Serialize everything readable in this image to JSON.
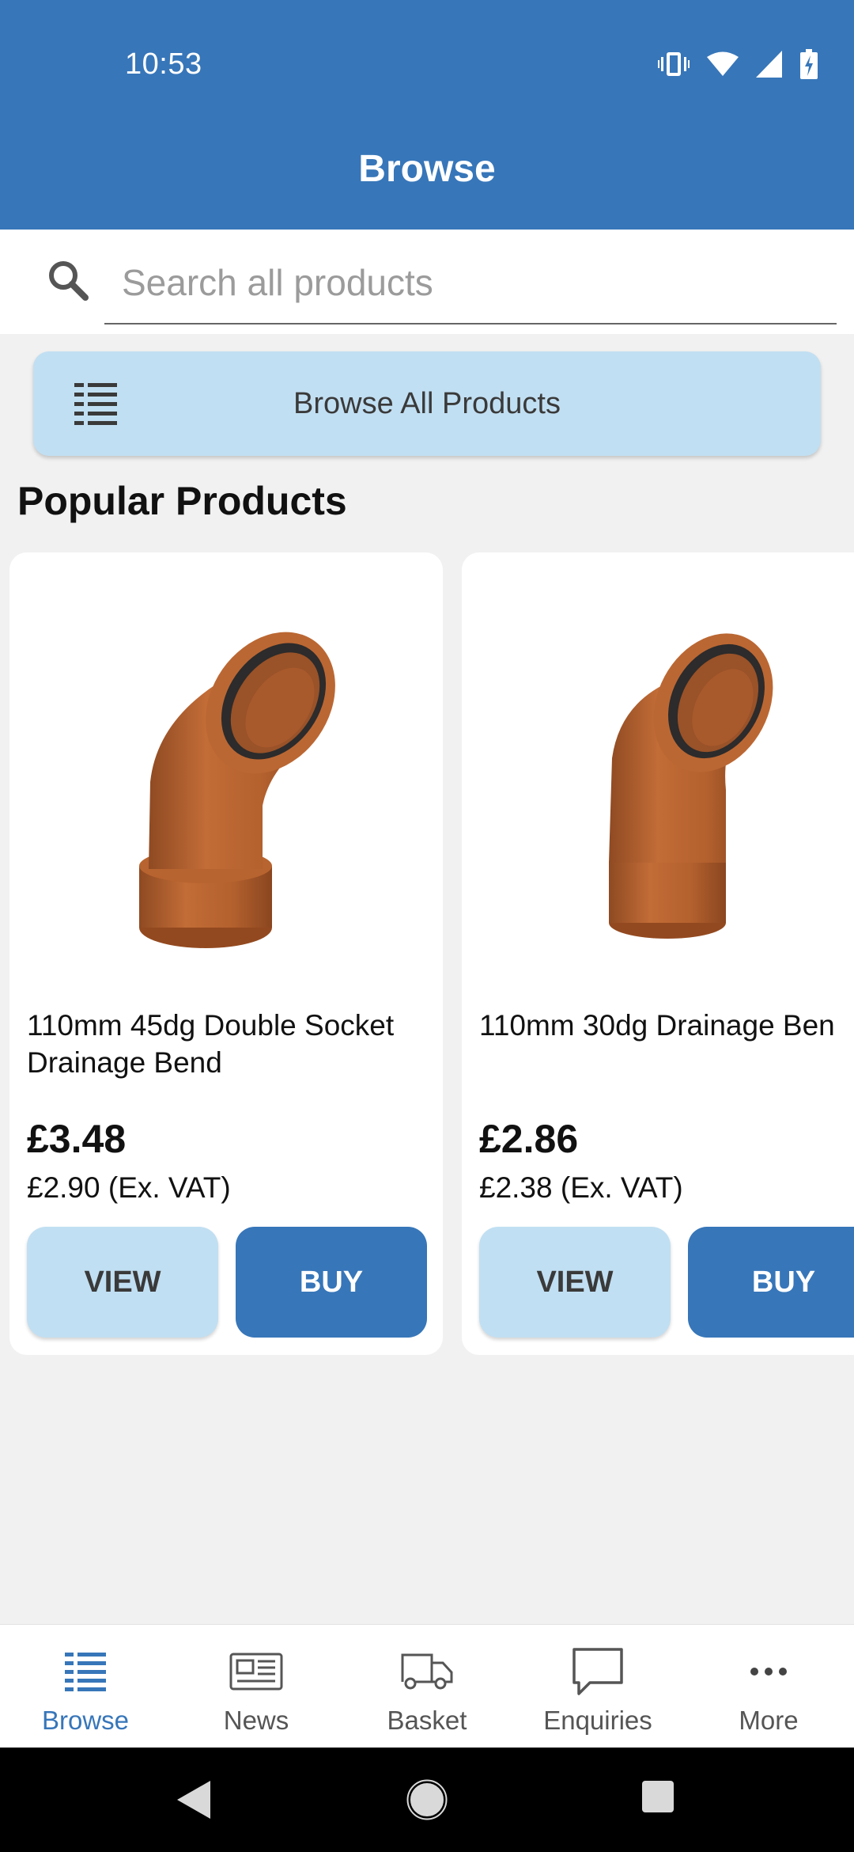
{
  "status_bar": {
    "time": "10:53",
    "icons": [
      "vibrate-icon",
      "wifi-icon",
      "signal-icon",
      "battery-charging-icon"
    ]
  },
  "header": {
    "title": "Browse"
  },
  "search": {
    "placeholder": "Search all products",
    "icon": "search-icon"
  },
  "browse_all": {
    "label": "Browse All Products",
    "icon": "list-icon"
  },
  "popular": {
    "title": "Popular Products",
    "products": [
      {
        "name": "110mm 45dg Double Socket Drainage Bend",
        "price": "£3.48",
        "price_ex_vat": "£2.90 (Ex. VAT)",
        "view_label": "VIEW",
        "buy_label": "BUY"
      },
      {
        "name": "110mm 30dg Drainage Ben",
        "price": "£2.86",
        "price_ex_vat": "£2.38 (Ex. VAT)",
        "view_label": "VIEW",
        "buy_label": "BUY"
      }
    ]
  },
  "bottom_nav": {
    "items": [
      {
        "label": "Browse",
        "icon": "list-icon",
        "active": true
      },
      {
        "label": "News",
        "icon": "newspaper-icon",
        "active": false
      },
      {
        "label": "Basket",
        "icon": "truck-icon",
        "active": false
      },
      {
        "label": "Enquiries",
        "icon": "chat-bubble-icon",
        "active": false
      },
      {
        "label": "More",
        "icon": "more-dots-icon",
        "active": false
      }
    ]
  },
  "colors": {
    "primary": "#3776b9",
    "light_blue": "#c1dff2",
    "background": "#f1f1f1",
    "pipe_brown": "#b4612e"
  }
}
